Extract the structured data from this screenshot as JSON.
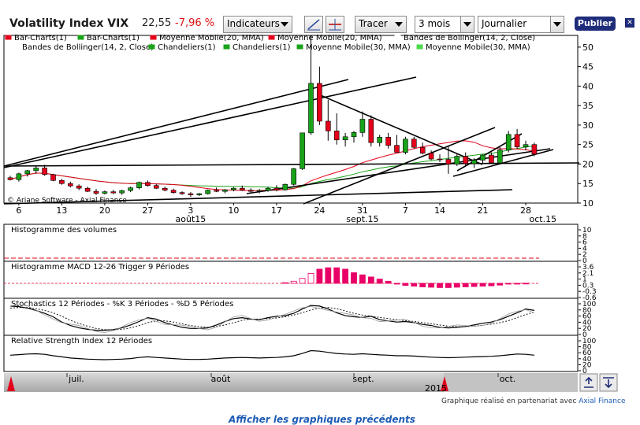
{
  "header": {
    "title": "Volatility Index VIX",
    "price": "22,55",
    "change": "-7,96 %",
    "indicators_label": "Indicateurs",
    "tracer_label": "Tracer",
    "period_label": "3 mois",
    "interval_label": "Journalier",
    "publish_label": "Publier"
  },
  "legend": [
    {
      "label": "Bar-Charts(1)",
      "color": "#e4001b"
    },
    {
      "label": "Bar-Charts(1)",
      "color": "#19a319"
    },
    {
      "label": "Moyenne Mobile(20, MMA)",
      "color": "#e4001b"
    },
    {
      "label": "Moyenne Mobile(20, MMA)",
      "color": "#e4001b"
    },
    {
      "label": "Bandes de Bollinger(14, 2, Close)",
      "color": "#ffffff"
    },
    {
      "label": "Bandes de Bollinger(14, 2, Close)",
      "color": "#ffffff"
    },
    {
      "label": "Chandeliers(1)",
      "color": "#19a319"
    },
    {
      "label": "Chandeliers(1)",
      "color": "#19a319"
    },
    {
      "label": "Moyenne Mobile(30, MMA)",
      "color": "#19a319"
    },
    {
      "label": "Moyenne Mobile(30, MMA)",
      "color": "#4cd94c"
    }
  ],
  "chart_data": {
    "type": "candlestick",
    "y_ticks": [
      10,
      15,
      20,
      25,
      30,
      35,
      40,
      45,
      50
    ],
    "ylim": [
      10,
      53
    ],
    "x_ticks": [
      {
        "label": "6",
        "i": 1
      },
      {
        "label": "13",
        "i": 6
      },
      {
        "label": "20",
        "i": 11
      },
      {
        "label": "27",
        "i": 16
      },
      {
        "label": "3",
        "i": 21
      },
      {
        "label": "10",
        "i": 26
      },
      {
        "label": "17",
        "i": 31
      },
      {
        "label": "24",
        "i": 36
      },
      {
        "label": "31",
        "i": 41
      },
      {
        "label": "7",
        "i": 46
      },
      {
        "label": "14",
        "i": 50
      },
      {
        "label": "21",
        "i": 55
      },
      {
        "label": "28",
        "i": 60
      }
    ],
    "month_labels": [
      {
        "label": "août15",
        "i": 21
      },
      {
        "label": "sept.15",
        "i": 41
      },
      {
        "label": "oct.15",
        "i": 62
      }
    ],
    "copyright": "© Ariane Software - Axial Finance",
    "candles": [
      [
        16.5,
        17.0,
        15.8,
        16.0
      ],
      [
        16.0,
        17.8,
        15.5,
        17.5
      ],
      [
        17.5,
        18.5,
        16.8,
        18.3
      ],
      [
        18.3,
        19.5,
        17.5,
        19.0
      ],
      [
        19.0,
        19.8,
        17.0,
        17.3
      ],
      [
        17.3,
        17.5,
        15.6,
        15.8
      ],
      [
        15.8,
        16.2,
        14.7,
        15.0
      ],
      [
        15.0,
        15.5,
        14.0,
        14.4
      ],
      [
        14.4,
        14.8,
        13.3,
        13.8
      ],
      [
        13.8,
        14.2,
        12.8,
        13.0
      ],
      [
        13.0,
        13.6,
        12.1,
        12.5
      ],
      [
        12.5,
        13.2,
        12.2,
        12.9
      ],
      [
        12.9,
        13.4,
        12.3,
        12.6
      ],
      [
        12.6,
        13.4,
        12.1,
        13.2
      ],
      [
        13.2,
        14.2,
        12.8,
        13.9
      ],
      [
        13.9,
        15.5,
        13.5,
        15.3
      ],
      [
        15.3,
        15.8,
        14.2,
        14.5
      ],
      [
        14.5,
        14.9,
        13.6,
        13.8
      ],
      [
        13.8,
        14.2,
        13.0,
        13.3
      ],
      [
        13.3,
        13.7,
        12.4,
        12.7
      ],
      [
        12.7,
        13.0,
        12.1,
        12.4
      ],
      [
        12.4,
        12.8,
        11.6,
        12.1
      ],
      [
        12.1,
        12.6,
        11.8,
        12.4
      ],
      [
        12.4,
        13.5,
        12.2,
        13.3
      ],
      [
        13.3,
        14.0,
        12.8,
        13.0
      ],
      [
        13.0,
        13.6,
        12.5,
        13.4
      ],
      [
        13.4,
        14.1,
        13.0,
        13.8
      ],
      [
        13.8,
        14.5,
        13.1,
        13.3
      ],
      [
        13.3,
        13.8,
        12.5,
        13.0
      ],
      [
        13.0,
        13.6,
        12.5,
        13.2
      ],
      [
        13.2,
        14.2,
        12.9,
        13.8
      ],
      [
        13.8,
        14.6,
        13.0,
        13.4
      ],
      [
        13.4,
        15.0,
        13.2,
        14.8
      ],
      [
        14.8,
        19.0,
        14.5,
        18.8
      ],
      [
        18.8,
        28.0,
        18.5,
        28.0
      ],
      [
        28.0,
        53.0,
        27.5,
        40.7
      ],
      [
        40.7,
        45.0,
        30.0,
        31.0
      ],
      [
        31.0,
        36.5,
        26.0,
        28.5
      ],
      [
        28.5,
        33.0,
        25.0,
        26.2
      ],
      [
        26.2,
        28.0,
        24.5,
        27.0
      ],
      [
        27.0,
        28.5,
        25.5,
        28.1
      ],
      [
        28.1,
        33.5,
        27.0,
        31.5
      ],
      [
        31.5,
        32.5,
        24.5,
        25.5
      ],
      [
        25.5,
        27.5,
        24.5,
        26.9
      ],
      [
        26.9,
        28.0,
        24.0,
        24.8
      ],
      [
        24.8,
        27.5,
        23.0,
        23.0
      ],
      [
        23.0,
        27.0,
        22.5,
        26.4
      ],
      [
        26.4,
        27.0,
        24.0,
        24.3
      ],
      [
        24.3,
        25.5,
        22.5,
        22.8
      ],
      [
        22.8,
        23.5,
        21.0,
        21.3
      ],
      [
        21.3,
        22.5,
        20.5,
        21.2
      ],
      [
        21.2,
        24.5,
        17.5,
        20.0
      ],
      [
        20.0,
        22.5,
        19.5,
        22.0
      ],
      [
        22.0,
        23.0,
        19.5,
        20.1
      ],
      [
        20.1,
        21.5,
        19.0,
        21.0
      ],
      [
        21.0,
        22.5,
        20.0,
        22.3
      ],
      [
        22.3,
        23.0,
        20.0,
        20.3
      ],
      [
        20.3,
        24.5,
        20.0,
        23.6
      ],
      [
        23.6,
        28.5,
        23.0,
        27.6
      ],
      [
        27.6,
        29.0,
        24.0,
        24.4
      ],
      [
        24.4,
        26.0,
        23.5,
        25.0
      ],
      [
        25.0,
        25.5,
        22.0,
        22.55
      ]
    ],
    "lower_panels": [
      {
        "title": "Histogramme des volumes",
        "ticks": [
          "10",
          "8",
          "6",
          "4",
          "2",
          "0"
        ]
      },
      {
        "title": "Histogramme MACD 12-26   Trigger 9 Périodes",
        "ticks": [
          "3.6",
          "2.1",
          "1",
          "0.3",
          "-0.3",
          "-0.6"
        ]
      },
      {
        "title": "Stochastics 12 Périodes  -  %K 3 Périodes  -  %D 5 Périodes",
        "ticks": [
          "100",
          "80",
          "60",
          "40",
          "20",
          "0"
        ]
      },
      {
        "title": "Relative Strength Index 12 Périodes",
        "ticks": [
          "100",
          "80",
          "60",
          "40",
          "20",
          "0"
        ]
      }
    ],
    "macd": [
      0,
      0,
      0,
      0,
      0,
      0,
      0,
      0,
      0,
      0,
      0,
      0,
      0,
      0,
      0,
      0,
      0,
      0,
      0,
      0,
      0,
      0,
      0,
      0,
      0,
      0,
      0,
      0,
      0,
      0,
      0,
      0,
      0.1,
      0.3,
      0.7,
      1.4,
      2.0,
      2.2,
      2.2,
      2.0,
      1.5,
      1.2,
      0.9,
      0.6,
      0.3,
      -0.1,
      -0.3,
      -0.4,
      -0.5,
      -0.55,
      -0.6,
      -0.6,
      -0.55,
      -0.5,
      -0.45,
      -0.4,
      -0.35,
      -0.25,
      -0.1,
      -0.05,
      0.02,
      0
    ],
    "stoch_k": [
      95,
      93,
      88,
      80,
      70,
      58,
      40,
      28,
      20,
      15,
      12,
      12,
      14,
      20,
      30,
      42,
      55,
      50,
      38,
      30,
      22,
      18,
      18,
      20,
      30,
      42,
      52,
      55,
      50,
      48,
      55,
      60,
      62,
      70,
      85,
      97,
      95,
      85,
      72,
      62,
      58,
      56,
      60,
      48,
      44,
      40,
      42,
      38,
      32,
      28,
      22,
      20,
      22,
      25,
      30,
      36,
      40,
      48,
      60,
      72,
      85,
      80
    ],
    "stoch_d": [
      88,
      90,
      90,
      86,
      80,
      72,
      60,
      46,
      35,
      26,
      18,
      14,
      13,
      15,
      20,
      28,
      38,
      44,
      44,
      40,
      34,
      28,
      24,
      22,
      25,
      30,
      38,
      46,
      50,
      50,
      52,
      54,
      58,
      64,
      72,
      82,
      88,
      90,
      86,
      78,
      70,
      64,
      60,
      56,
      52,
      48,
      45,
      42,
      38,
      34,
      30,
      26,
      24,
      24,
      26,
      29,
      33,
      38,
      45,
      55,
      66,
      74
    ],
    "rsi": [
      52,
      54,
      56,
      57,
      55,
      50,
      46,
      42,
      40,
      38,
      37,
      36,
      37,
      38,
      40,
      44,
      46,
      44,
      42,
      40,
      38,
      37,
      37,
      38,
      40,
      42,
      43,
      44,
      43,
      42,
      43,
      44,
      46,
      50,
      58,
      68,
      66,
      62,
      58,
      56,
      55,
      57,
      55,
      53,
      52,
      50,
      50,
      49,
      47,
      45,
      44,
      43,
      44,
      45,
      46,
      47,
      48,
      50,
      53,
      56,
      55,
      52
    ],
    "timeline": {
      "labels": [
        {
          "label": "juil.",
          "x": 97
        },
        {
          "label": "août",
          "x": 280
        },
        {
          "label": "sept.",
          "x": 461
        },
        {
          "label": "oct.",
          "x": 644
        }
      ],
      "year_label": "2015"
    }
  },
  "footer": {
    "partner_text": "Graphique réalisé en partenariat avec",
    "partner_link": "Axial Finance",
    "below_text": "Afficher les graphiques précédents"
  }
}
